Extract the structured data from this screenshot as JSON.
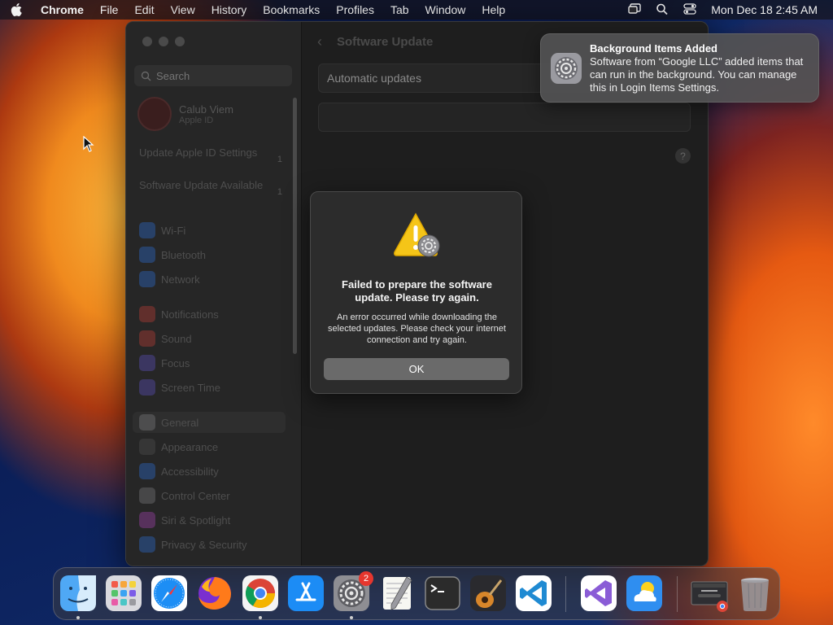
{
  "menubar": {
    "app_name": "Chrome",
    "items": [
      "File",
      "Edit",
      "View",
      "History",
      "Bookmarks",
      "Profiles",
      "Tab",
      "Window",
      "Help"
    ],
    "clock": "Mon Dec 18  2:45 AM"
  },
  "settings": {
    "search_placeholder": "Search",
    "profile": {
      "name": "Calub Viem",
      "sub": "Apple ID"
    },
    "pending": [
      {
        "label": "Update Apple ID Settings",
        "count": "1"
      },
      {
        "label": "Software Update Available",
        "count": "1"
      }
    ],
    "sidebar_items": [
      {
        "label": "Wi-Fi",
        "color": "#2f7cf6"
      },
      {
        "label": "Bluetooth",
        "color": "#2f7cf6"
      },
      {
        "label": "Network",
        "color": "#2f7cf6"
      },
      {
        "label": "Notifications",
        "color": "#e0443a"
      },
      {
        "label": "Sound",
        "color": "#e0443a"
      },
      {
        "label": "Focus",
        "color": "#6b5be0"
      },
      {
        "label": "Screen Time",
        "color": "#6b5be0"
      },
      {
        "label": "General",
        "color": "#8e8e93"
      },
      {
        "label": "Appearance",
        "color": "#3a3a3a"
      },
      {
        "label": "Accessibility",
        "color": "#2f7cf6"
      },
      {
        "label": "Control Center",
        "color": "#8e8e93"
      },
      {
        "label": "Siri & Spotlight",
        "color": "#c04ad0"
      },
      {
        "label": "Privacy & Security",
        "color": "#2f7cf6"
      }
    ],
    "page_title": "Software Update",
    "automatic_updates_label": "Automatic updates",
    "help_label": "?"
  },
  "alert": {
    "title": "Failed to prepare the software update. Please try again.",
    "message": "An error occurred while downloading the selected updates. Please check your internet connection and try again.",
    "ok_label": "OK"
  },
  "notification": {
    "title": "Background Items Added",
    "body": "Software from “Google LLC” added items that can run in the background. You can manage this in Login Items Settings."
  },
  "dock": {
    "apps": [
      {
        "name": "finder-app"
      },
      {
        "name": "launchpad-app"
      },
      {
        "name": "safari-app"
      },
      {
        "name": "firefox-app"
      },
      {
        "name": "chrome-app"
      },
      {
        "name": "app-store-app"
      },
      {
        "name": "system-settings-app"
      },
      {
        "name": "textedit-app"
      },
      {
        "name": "terminal-app"
      },
      {
        "name": "garageband-app"
      },
      {
        "name": "vscode-app"
      },
      {
        "name": "visual-studio-app"
      },
      {
        "name": "weather-app"
      },
      {
        "name": "chrome-window-thumbnail"
      },
      {
        "name": "trash"
      }
    ],
    "settings_badge": "2"
  }
}
